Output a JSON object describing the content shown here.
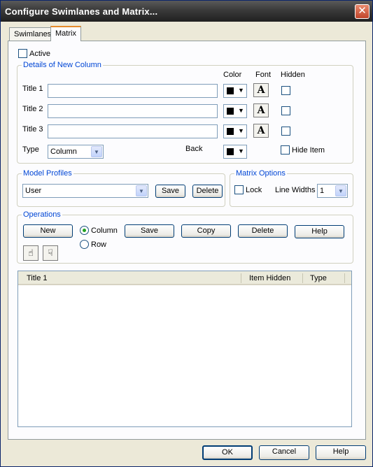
{
  "window": {
    "title": "Configure Swimlanes and Matrix...",
    "close_glyph": "✕"
  },
  "tabs": [
    {
      "label": "Swimlanes"
    },
    {
      "label": "Matrix"
    }
  ],
  "active_checkbox": {
    "label": "Active",
    "checked": false
  },
  "details": {
    "legend": "Details of New Column",
    "col_headers": {
      "color": "Color",
      "font": "Font",
      "hidden": "Hidden"
    },
    "rows": [
      {
        "label": "Title 1",
        "value": "",
        "color": "#000000",
        "hidden": false
      },
      {
        "label": "Title 2",
        "value": "",
        "color": "#000000",
        "hidden": false
      },
      {
        "label": "Title 3",
        "value": "",
        "color": "#000000",
        "hidden": false
      }
    ],
    "type_label": "Type",
    "type_value": "Column",
    "back_label": "Back",
    "back_color": "#000000",
    "hide_item_label": "Hide Item",
    "font_glyph": "A"
  },
  "model_profiles": {
    "legend": "Model Profiles",
    "selected": "User",
    "save_label": "Save",
    "delete_label": "Delete"
  },
  "matrix_options": {
    "legend": "Matrix Options",
    "lock_label": "Lock",
    "line_widths_label": "Line Widths",
    "line_widths_value": "1"
  },
  "operations": {
    "legend": "Operations",
    "new_label": "New",
    "column_label": "Column",
    "row_label": "Row",
    "selected": "Column",
    "save_label": "Save",
    "copy_label": "Copy",
    "delete_label": "Delete",
    "help_label": "Help"
  },
  "list": {
    "columns": [
      "Title 1",
      "Item Hidden",
      "Type"
    ],
    "rows": []
  },
  "footer": {
    "ok_label": "OK",
    "cancel_label": "Cancel",
    "help_label": "Help"
  },
  "colors": {
    "accent": "#0046d5",
    "tab_highlight": "#e68b2c",
    "dialog_bg": "#ece9d8"
  }
}
